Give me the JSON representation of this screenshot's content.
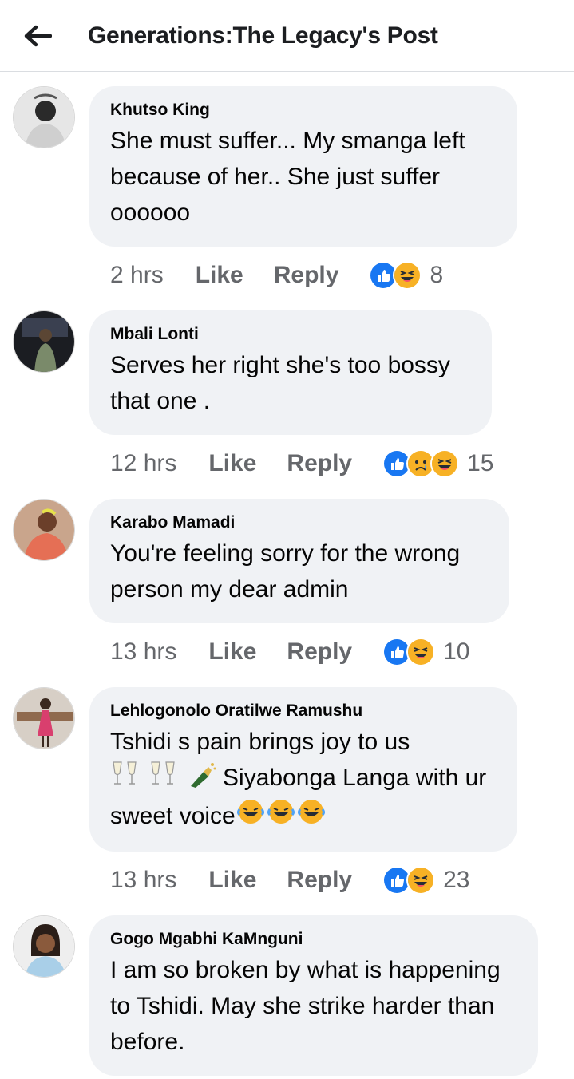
{
  "header": {
    "title": "Generations:The Legacy's Post"
  },
  "comments": [
    {
      "author": "Khutso King",
      "text": "She must suffer... My smanga left because of her..  She just suffer oooooo",
      "time": "2 hrs",
      "like": "Like",
      "reply": "Reply",
      "reactions": [
        "like",
        "haha"
      ],
      "count": "8"
    },
    {
      "author": "Mbali Lonti",
      "text": "Serves her right she's too bossy that one .",
      "time": "12 hrs",
      "like": "Like",
      "reply": "Reply",
      "reactions": [
        "like",
        "sad",
        "haha"
      ],
      "count": "15"
    },
    {
      "author": "Karabo Mamadi",
      "text": "You're feeling sorry for the wrong person my dear admin",
      "time": "13 hrs",
      "like": "Like",
      "reply": "Reply",
      "reactions": [
        "like",
        "haha"
      ],
      "count": "10"
    },
    {
      "author": "Lehlogonolo Oratilwe Ramushu",
      "text_line1": "Tshidi s pain brings joy to us",
      "text_line2": "Siyabonga Langa with ur",
      "text_line3": "sweet voice",
      "time": "13 hrs",
      "like": "Like",
      "reply": "Reply",
      "reactions": [
        "like",
        "haha"
      ],
      "count": "23"
    },
    {
      "author": "Gogo Mgabhi KaMnguni",
      "text": "I am so broken by what is happening to Tshidi. May she strike harder than before."
    }
  ],
  "colors": {
    "like_blue": "#1877f2",
    "haha_yellow": "#f7b125",
    "bubble_bg": "#f0f2f5",
    "meta_gray": "#65676b"
  }
}
